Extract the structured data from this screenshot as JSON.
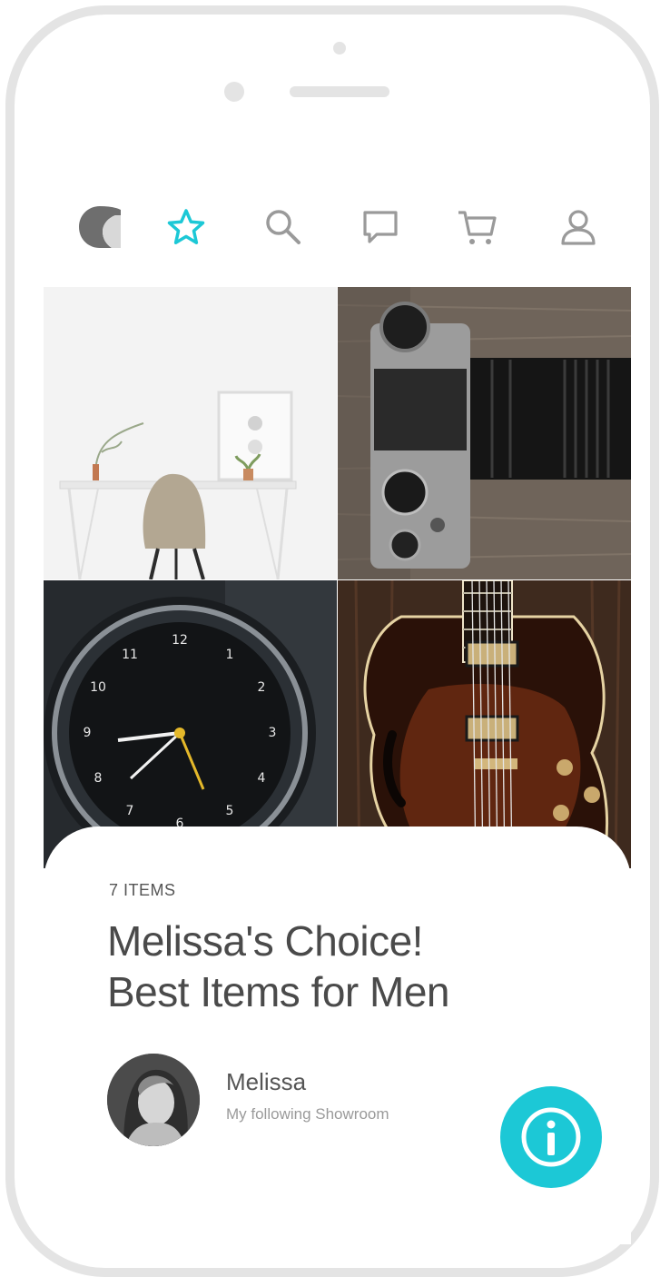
{
  "nav": {
    "items": [
      {
        "icon": "logo-icon"
      },
      {
        "icon": "star-icon",
        "active": true
      },
      {
        "icon": "search-icon"
      },
      {
        "icon": "chat-icon"
      },
      {
        "icon": "cart-icon"
      },
      {
        "icon": "user-icon"
      }
    ],
    "active_color": "#1cc8d6",
    "inactive_color": "#9a9a9a"
  },
  "grid": {
    "tiles": [
      {
        "subject": "desk-chair-photo"
      },
      {
        "subject": "camera-photo"
      },
      {
        "subject": "watch-photo"
      },
      {
        "subject": "guitar-photo"
      }
    ]
  },
  "showroom": {
    "item_count": "7 ITEMS",
    "title_line1": "Melissa's Choice!",
    "title_line2": "Best Items for Men",
    "owner_name": "Melissa",
    "owner_subtitle": "My following Showroom"
  },
  "info_button": {
    "icon": "info-icon",
    "color": "#1cc8d6"
  }
}
